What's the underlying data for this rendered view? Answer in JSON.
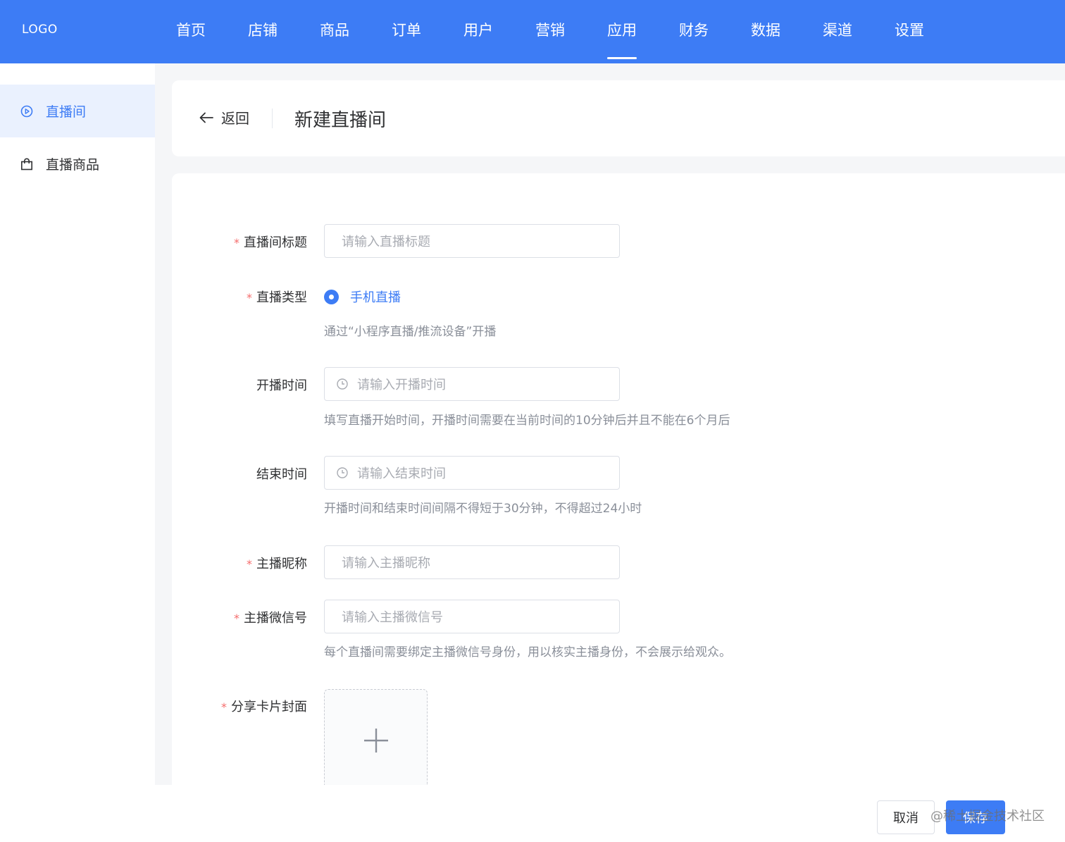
{
  "brand": {
    "logo": "LOGO",
    "accent": "#3d7cf5"
  },
  "nav": {
    "items": [
      "首页",
      "店铺",
      "商品",
      "订单",
      "用户",
      "营销",
      "应用",
      "财务",
      "数据",
      "渠道",
      "设置"
    ],
    "active": "应用"
  },
  "sidebar": {
    "items": [
      {
        "label": "直播间",
        "icon": "play-circle-icon",
        "active": true
      },
      {
        "label": "直播商品",
        "icon": "shopping-bag-icon",
        "active": false
      }
    ]
  },
  "header": {
    "back_label": "返回",
    "title": "新建直播间"
  },
  "form": {
    "room_title": {
      "label": "直播间标题",
      "required": true,
      "placeholder": "请输入直播标题"
    },
    "live_type": {
      "label": "直播类型",
      "required": true,
      "option": "手机直播",
      "hint": "通过“小程序直播/推流设备”开播"
    },
    "start_time": {
      "label": "开播时间",
      "required": false,
      "placeholder": "请输入开播时间",
      "hint": "填写直播开始时间，开播时间需要在当前时间的10分钟后并且不能在6个月后"
    },
    "end_time": {
      "label": "结束时间",
      "required": false,
      "placeholder": "请输入结束时间",
      "hint": "开播时间和结束时间间隔不得短于30分钟，不得超过24小时"
    },
    "anchor_nickname": {
      "label": "主播昵称",
      "required": true,
      "placeholder": "请输入主播昵称"
    },
    "anchor_wechat": {
      "label": "主播微信号",
      "required": true,
      "placeholder": "请输入主播微信号",
      "hint": "每个直播间需要绑定主播微信号身份，用以核实主播身份，不会展示给观众。"
    },
    "share_cover": {
      "label": "分享卡片封面",
      "required": true
    }
  },
  "footer": {
    "cancel_label": "取消",
    "save_label": "保存",
    "watermark": "@稀土掘金技术社区"
  }
}
